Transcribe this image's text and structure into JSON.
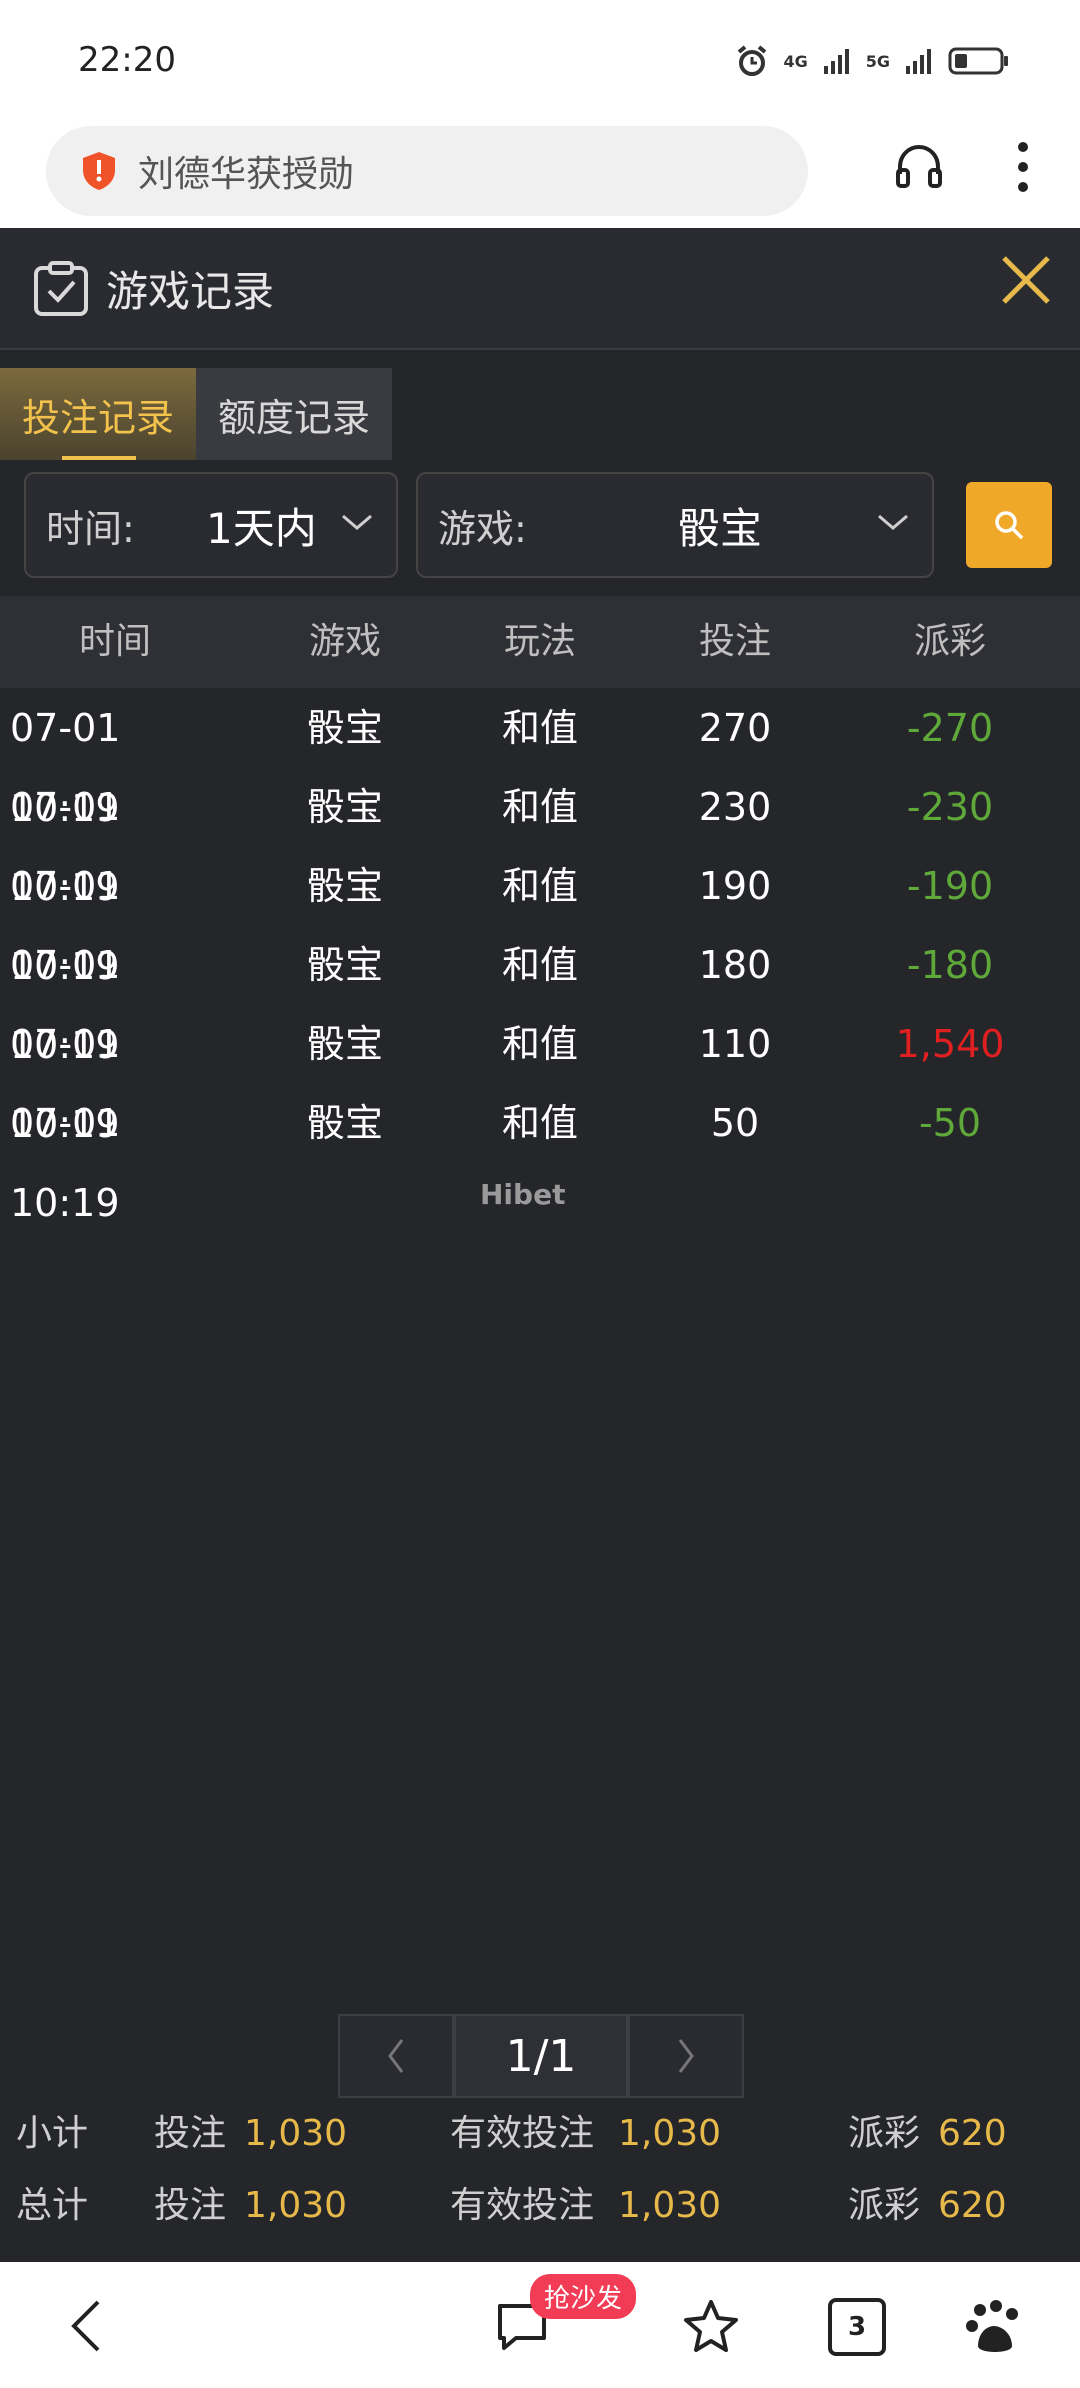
{
  "status": {
    "time": "22:20",
    "net1": "4G",
    "net2": "5G"
  },
  "urlbar": {
    "query": "刘德华获授勋"
  },
  "panel": {
    "title": "游戏记录",
    "tabs": [
      {
        "label": "投注记录",
        "active": true
      },
      {
        "label": "额度记录",
        "active": false
      }
    ],
    "filter_time": {
      "label": "时间:",
      "value": "1天内"
    },
    "filter_game": {
      "label": "游戏:",
      "value": "骰宝"
    },
    "columns": [
      "时间",
      "游戏",
      "玩法",
      "投注",
      "派彩"
    ],
    "rows": [
      {
        "time": "07-01 10:19",
        "game": "骰宝",
        "play": "和值",
        "bet": "270",
        "payout": "-270",
        "status": "loss"
      },
      {
        "time": "07-01 10:19",
        "game": "骰宝",
        "play": "和值",
        "bet": "230",
        "payout": "-230",
        "status": "loss"
      },
      {
        "time": "07-01 10:19",
        "game": "骰宝",
        "play": "和值",
        "bet": "190",
        "payout": "-190",
        "status": "loss"
      },
      {
        "time": "07-01 10:19",
        "game": "骰宝",
        "play": "和值",
        "bet": "180",
        "payout": "-180",
        "status": "loss"
      },
      {
        "time": "07-01 10:19",
        "game": "骰宝",
        "play": "和值",
        "bet": "110",
        "payout": "1,540",
        "status": "win"
      },
      {
        "time": "07-01 10:19",
        "game": "骰宝",
        "play": "和值",
        "bet": "50",
        "payout": "-50",
        "status": "loss"
      }
    ],
    "watermark": "Hibet",
    "pager": {
      "page": "1/1"
    },
    "subtotal": {
      "label": "小计",
      "bet_label": "投注",
      "bet": "1,030",
      "valid_label": "有效投注",
      "valid": "1,030",
      "payout_label": "派彩",
      "payout": "620"
    },
    "total": {
      "label": "总计",
      "bet_label": "投注",
      "bet": "1,030",
      "valid_label": "有效投注",
      "valid": "1,030",
      "payout_label": "派彩",
      "payout": "620"
    }
  },
  "bottombar": {
    "badge": "抢沙发",
    "tab_count": "3"
  },
  "colors": {
    "loss": "#5fa83a",
    "win": "#e02020",
    "accent": "#f0a828"
  }
}
